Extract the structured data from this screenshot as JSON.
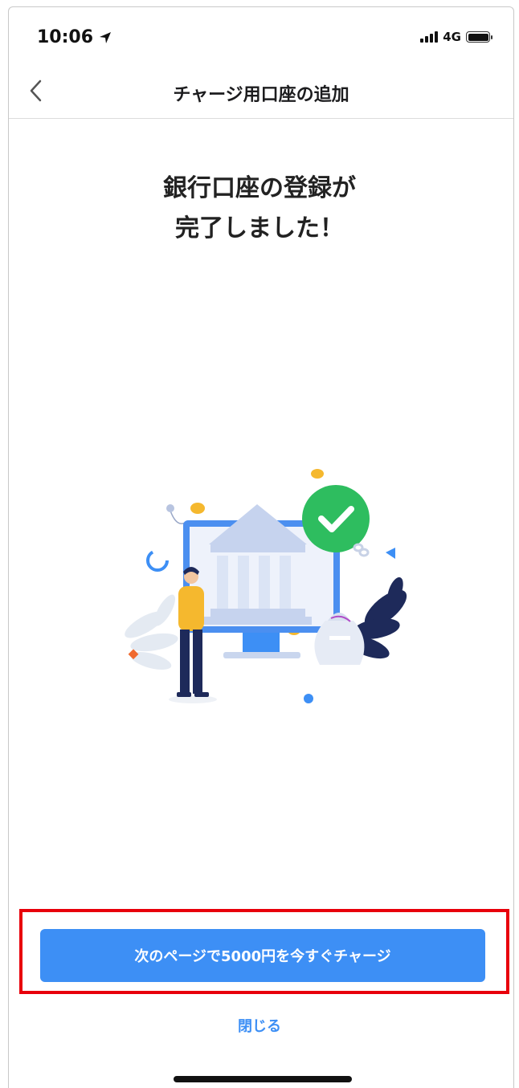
{
  "status_bar": {
    "time": "10:06",
    "network": "4G"
  },
  "nav": {
    "title": "チャージ用口座の追加"
  },
  "main": {
    "heading_line1": "銀行口座の登録が",
    "heading_line2": "完了しました！"
  },
  "actions": {
    "primary_label": "次のページで5000円を今すぐチャージ",
    "close_label": "閉じる"
  },
  "colors": {
    "accent": "#3d8ff5",
    "highlight_border": "#e8000b",
    "success": "#2ebd5f"
  },
  "icons": {
    "back": "chevron-left-icon",
    "location": "location-arrow-icon",
    "success": "check-circle-icon"
  }
}
